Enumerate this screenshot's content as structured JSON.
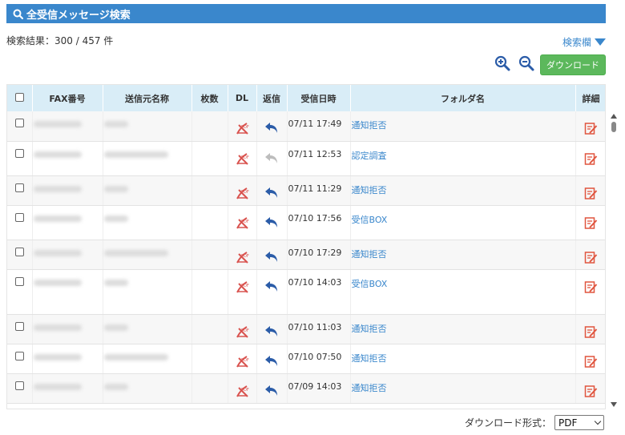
{
  "title": "全受信メッセージ検索",
  "result_count": "検索結果：300 / 457 件",
  "search_toggle": "検索欄",
  "download_button": "ダウンロード",
  "columns": [
    "FAX番号",
    "送信元名称",
    "枚数",
    "DL",
    "返信",
    "受信日時",
    "フォルダ名",
    "詳細"
  ],
  "rows": [
    {
      "date": "07/11 17:49",
      "folder": "通知拒否",
      "reply_active": true
    },
    {
      "date": "07/11 12:53",
      "folder": "認定調査",
      "reply_active": false
    },
    {
      "date": "07/11 11:29",
      "folder": "通知拒否",
      "reply_active": true
    },
    {
      "date": "07/10 17:56",
      "folder": "受信BOX",
      "reply_active": true
    },
    {
      "date": "07/10 17:29",
      "folder": "通知拒否",
      "reply_active": true
    },
    {
      "date": "07/10 14:03",
      "folder": "受信BOX",
      "reply_active": true
    },
    {
      "date": "07/10 11:03",
      "folder": "通知拒否",
      "reply_active": true
    },
    {
      "date": "07/10 07:50",
      "folder": "通知拒否",
      "reply_active": true
    },
    {
      "date": "07/09 14:03",
      "folder": "通知拒否",
      "reply_active": true
    }
  ],
  "format_label": "ダウンロード形式：",
  "format_value": "PDF",
  "colors": {
    "accent": "#3a87cc",
    "header_bg": "#d9edf7",
    "download_green": "#5cb85c",
    "pdf_red": "#d9534f",
    "detail_red": "#e0553f"
  }
}
